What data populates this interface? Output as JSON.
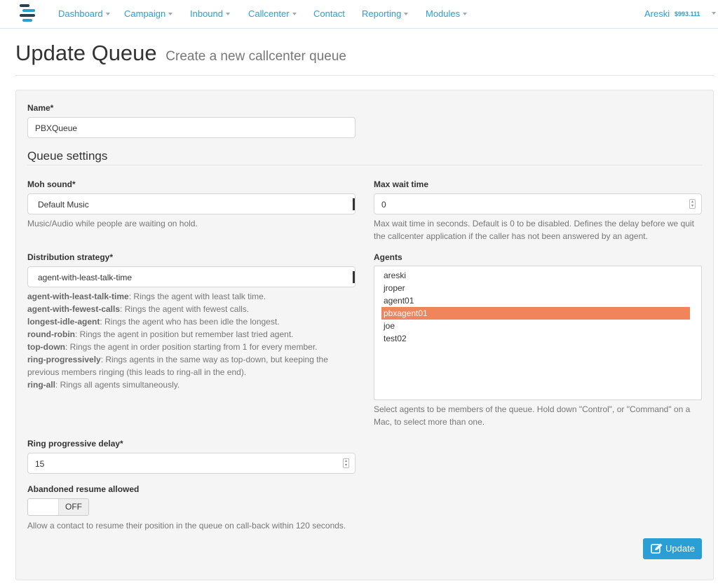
{
  "nav": {
    "items": [
      {
        "label": "Dashboard",
        "has_caret": true
      },
      {
        "label": "Campaign",
        "has_caret": true
      },
      {
        "label": "Inbound",
        "has_caret": true
      },
      {
        "label": "Callcenter",
        "has_caret": true
      },
      {
        "label": "Contact",
        "has_caret": false
      },
      {
        "label": "Reporting",
        "has_caret": true
      },
      {
        "label": "Modules",
        "has_caret": true
      }
    ],
    "user": "Areski",
    "balance": "$993.111"
  },
  "header": {
    "title": "Update Queue",
    "subtitle": "Create a new callcenter queue"
  },
  "form": {
    "name_label": "Name*",
    "name_value": "PBXQueue",
    "section_title": "Queue settings",
    "moh_label": "Moh sound*",
    "moh_value": "Default Music",
    "moh_help": "Music/Audio while people are waiting on hold.",
    "maxwait_label": "Max wait time",
    "maxwait_value": "0",
    "maxwait_help": "Max wait time in seconds. Default is 0 to be disabled. Defines the delay before we quit the callcenter application if the caller has not been answered by an agent.",
    "strategy_label": "Distribution strategy*",
    "strategy_value": "agent-with-least-talk-time",
    "strategy_help": [
      {
        "term": "agent-with-least-talk-time",
        "desc": ": Rings the agent with least talk time."
      },
      {
        "term": "agent-with-fewest-calls",
        "desc": ": Rings the agent with fewest calls."
      },
      {
        "term": "longest-idle-agent",
        "desc": ": Rings the agent who has been idle the longest."
      },
      {
        "term": "round-robin",
        "desc": ": Rings the agent in position but remember last tried agent."
      },
      {
        "term": "top-down",
        "desc": ": Rings the agent in order position starting from 1 for every member."
      },
      {
        "term": "ring-progressively",
        "desc": ": Rings agents in the same way as top-down, but keeping the previous members ringing (this leads to ring-all in the end)."
      },
      {
        "term": "ring-all",
        "desc": ": Rings all agents simultaneously."
      }
    ],
    "agents_label": "Agents",
    "agents": [
      {
        "label": "areski",
        "selected": false
      },
      {
        "label": "jroper",
        "selected": false
      },
      {
        "label": "agent01",
        "selected": false
      },
      {
        "label": "pbxagent01",
        "selected": true
      },
      {
        "label": "joe",
        "selected": false
      },
      {
        "label": "test02",
        "selected": false
      }
    ],
    "agents_help": "Select agents to be members of the queue. Hold down \"Control\", or \"Command\" on a Mac, to select more than one.",
    "ring_delay_label": "Ring progressive delay*",
    "ring_delay_value": "15",
    "abandoned_label": "Abandoned resume allowed",
    "abandoned_toggle": "OFF",
    "abandoned_help": "Allow a contact to resume their position in the queue on call-back within 120 seconds.",
    "update_label": "Update"
  },
  "colors": {
    "accent": "#2a9fd6",
    "selected_option": "#f0855b"
  }
}
